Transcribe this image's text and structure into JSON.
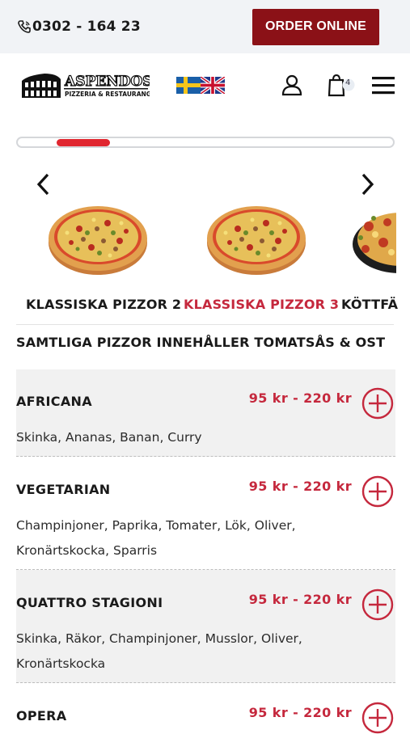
{
  "topbar": {
    "phone": "0302 - 164 23",
    "order_label": "ORDER ONLINE"
  },
  "header": {
    "logo_text": "ASPENDOS",
    "logo_subtitle": "PIZZERIA & RESTAURANG",
    "cart_count": "4"
  },
  "categories": [
    {
      "label": "KLASSISKA PIZZOR 2"
    },
    {
      "label": "KLASSISKA PIZZOR 3"
    },
    {
      "label": "KÖTTFÄ"
    }
  ],
  "notice": "SAMTLIGA PIZZOR INNEHÅLLER TOMATSÅS & OST",
  "menu": [
    {
      "name": "AFRICANA",
      "price": "95 kr  - 220 kr",
      "desc": "Skinka, Ananas, Banan, Curry"
    },
    {
      "name": "VEGETARIAN",
      "price": "95 kr  - 220 kr",
      "desc": "Champinjoner, Paprika, Tomater, Lök, Oliver, Kronärtskocka, Sparris"
    },
    {
      "name": "QUATTRO STAGIONI",
      "price": "95 kr  - 220 kr",
      "desc": "Skinka, Räkor, Champinjoner, Musslor, Oliver, Kronärtskocka"
    },
    {
      "name": "OPERA",
      "price": "95 kr  - 220 kr",
      "desc": ""
    }
  ],
  "colors": {
    "brand_red": "#8b1117",
    "accent_red": "#c5283d",
    "slider_red": "#e0262f"
  }
}
